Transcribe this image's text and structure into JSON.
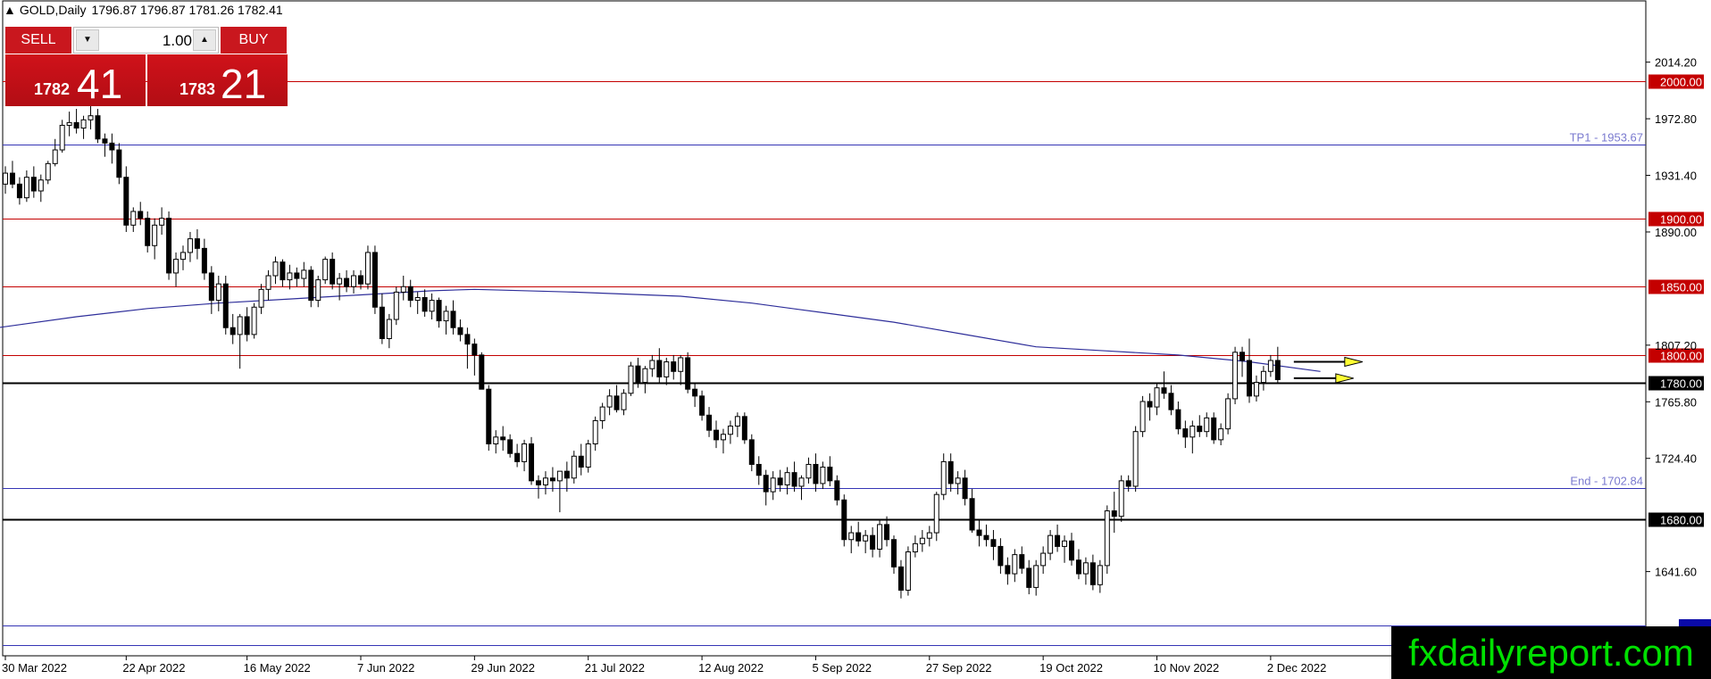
{
  "header": {
    "symbol": "GOLD,Daily",
    "ohlc": "1796.87 1796.87 1781.26 1782.41"
  },
  "trade_panel": {
    "sell_label": "SELL",
    "buy_label": "BUY",
    "lot": "1.00",
    "sell_price_small": "1782",
    "sell_price_big": "41",
    "buy_price_small": "1783",
    "buy_price_big": "21"
  },
  "brand": "fxdailyreport.com",
  "chart_data": {
    "type": "candlestick",
    "symbol": "GOLD",
    "timeframe": "Daily",
    "y_range": [
      1580,
      2059
    ],
    "y_ticks": [
      "2014.20",
      "1972.80",
      "1931.40",
      "1890.00",
      "1807.20",
      "1765.80",
      "1724.40",
      "1641.60"
    ],
    "x_ticks": [
      {
        "label": "30 Mar 2022",
        "index": 0
      },
      {
        "label": "22 Apr 2022",
        "index": 17
      },
      {
        "label": "16 May 2022",
        "index": 34
      },
      {
        "label": "7 Jun 2022",
        "index": 50
      },
      {
        "label": "29 Jun 2022",
        "index": 66
      },
      {
        "label": "21 Jul 2022",
        "index": 82
      },
      {
        "label": "12 Aug 2022",
        "index": 98
      },
      {
        "label": "5 Sep 2022",
        "index": 114
      },
      {
        "label": "27 Sep 2022",
        "index": 130
      },
      {
        "label": "19 Oct 2022",
        "index": 146
      },
      {
        "label": "10 Nov 2022",
        "index": 162
      },
      {
        "label": "2 Dec 2022",
        "index": 178
      }
    ],
    "bars_total": 186,
    "levels": [
      {
        "price": 2000.0,
        "label": "2000.00",
        "style": "red"
      },
      {
        "price": 1953.67,
        "label": "TP1 - 1953.67",
        "style": "blue-text"
      },
      {
        "price": 1900.0,
        "label": "1900.00",
        "style": "red"
      },
      {
        "price": 1850.0,
        "label": "1850.00",
        "style": "red"
      },
      {
        "price": 1800.0,
        "label": "1800.00",
        "style": "red"
      },
      {
        "price": 1780.0,
        "label": "1780.00",
        "style": "black"
      },
      {
        "price": 1702.84,
        "label": "End - 1702.84",
        "style": "blue-text"
      },
      {
        "price": 1680.0,
        "label": "1680.00",
        "style": "black"
      },
      {
        "price": 1602.0,
        "label": "",
        "style": "blue"
      },
      {
        "price": 1588.0,
        "label": "",
        "style": "blue"
      }
    ],
    "moving_average": {
      "color": "#2e2e9a",
      "points": [
        [
          -1,
          1820
        ],
        [
          10,
          1828
        ],
        [
          20,
          1834
        ],
        [
          30,
          1838
        ],
        [
          40,
          1841
        ],
        [
          50,
          1844
        ],
        [
          60,
          1847
        ],
        [
          66,
          1848
        ],
        [
          80,
          1846
        ],
        [
          95,
          1843
        ],
        [
          105,
          1838
        ],
        [
          115,
          1831
        ],
        [
          125,
          1824
        ],
        [
          135,
          1815
        ],
        [
          145,
          1806
        ],
        [
          155,
          1803
        ],
        [
          165,
          1800
        ],
        [
          175,
          1795
        ],
        [
          185,
          1788
        ]
      ]
    },
    "candles": [
      [
        1925,
        1938,
        1918,
        1933
      ],
      [
        1933,
        1942,
        1922,
        1925
      ],
      [
        1925,
        1930,
        1910,
        1915
      ],
      [
        1915,
        1935,
        1912,
        1930
      ],
      [
        1930,
        1938,
        1915,
        1920
      ],
      [
        1920,
        1932,
        1912,
        1928
      ],
      [
        1928,
        1942,
        1925,
        1940
      ],
      [
        1940,
        1958,
        1938,
        1950
      ],
      [
        1950,
        1972,
        1948,
        1968
      ],
      [
        1968,
        1978,
        1960,
        1970
      ],
      [
        1970,
        1980,
        1962,
        1966
      ],
      [
        1966,
        1975,
        1958,
        1972
      ],
      [
        1972,
        1990,
        1965,
        1975
      ],
      [
        1975,
        1980,
        1955,
        1958
      ],
      [
        1958,
        1962,
        1945,
        1955
      ],
      [
        1955,
        1962,
        1940,
        1950
      ],
      [
        1950,
        1955,
        1925,
        1930
      ],
      [
        1930,
        1938,
        1890,
        1895
      ],
      [
        1895,
        1908,
        1890,
        1905
      ],
      [
        1905,
        1912,
        1895,
        1900
      ],
      [
        1900,
        1905,
        1875,
        1880
      ],
      [
        1880,
        1900,
        1870,
        1895
      ],
      [
        1895,
        1908,
        1888,
        1900
      ],
      [
        1900,
        1905,
        1855,
        1860
      ],
      [
        1860,
        1875,
        1850,
        1870
      ],
      [
        1870,
        1880,
        1862,
        1875
      ],
      [
        1875,
        1890,
        1868,
        1885
      ],
      [
        1885,
        1892,
        1870,
        1878
      ],
      [
        1878,
        1885,
        1855,
        1860
      ],
      [
        1860,
        1865,
        1830,
        1840
      ],
      [
        1840,
        1858,
        1832,
        1852
      ],
      [
        1852,
        1858,
        1815,
        1820
      ],
      [
        1820,
        1830,
        1808,
        1815
      ],
      [
        1815,
        1830,
        1790,
        1828
      ],
      [
        1828,
        1835,
        1810,
        1815
      ],
      [
        1815,
        1838,
        1812,
        1835
      ],
      [
        1835,
        1852,
        1830,
        1848
      ],
      [
        1848,
        1862,
        1840,
        1858
      ],
      [
        1858,
        1872,
        1852,
        1868
      ],
      [
        1868,
        1870,
        1850,
        1855
      ],
      [
        1855,
        1866,
        1848,
        1860
      ],
      [
        1860,
        1864,
        1850,
        1856
      ],
      [
        1856,
        1868,
        1850,
        1862
      ],
      [
        1862,
        1865,
        1835,
        1840
      ],
      [
        1840,
        1858,
        1835,
        1855
      ],
      [
        1855,
        1872,
        1852,
        1870
      ],
      [
        1870,
        1875,
        1848,
        1852
      ],
      [
        1852,
        1860,
        1840,
        1856
      ],
      [
        1856,
        1862,
        1846,
        1850
      ],
      [
        1850,
        1862,
        1845,
        1858
      ],
      [
        1858,
        1862,
        1848,
        1852
      ],
      [
        1852,
        1880,
        1848,
        1875
      ],
      [
        1875,
        1880,
        1830,
        1835
      ],
      [
        1835,
        1845,
        1808,
        1812
      ],
      [
        1812,
        1830,
        1805,
        1826
      ],
      [
        1826,
        1850,
        1822,
        1846
      ],
      [
        1846,
        1858,
        1840,
        1850
      ],
      [
        1850,
        1855,
        1835,
        1840
      ],
      [
        1840,
        1846,
        1830,
        1842
      ],
      [
        1842,
        1848,
        1828,
        1832
      ],
      [
        1832,
        1845,
        1826,
        1840
      ],
      [
        1840,
        1842,
        1820,
        1825
      ],
      [
        1825,
        1836,
        1815,
        1832
      ],
      [
        1832,
        1840,
        1815,
        1820
      ],
      [
        1820,
        1826,
        1810,
        1815
      ],
      [
        1815,
        1820,
        1790,
        1808
      ],
      [
        1808,
        1812,
        1785,
        1800
      ],
      [
        1800,
        1802,
        1775,
        1775
      ],
      [
        1775,
        1778,
        1730,
        1735
      ],
      [
        1735,
        1745,
        1728,
        1740
      ],
      [
        1740,
        1748,
        1730,
        1738
      ],
      [
        1738,
        1742,
        1725,
        1728
      ],
      [
        1728,
        1735,
        1718,
        1722
      ],
      [
        1722,
        1738,
        1715,
        1735
      ],
      [
        1735,
        1740,
        1705,
        1708
      ],
      [
        1708,
        1712,
        1695,
        1705
      ],
      [
        1705,
        1715,
        1698,
        1710
      ],
      [
        1710,
        1718,
        1700,
        1708
      ],
      [
        1708,
        1712,
        1685,
        1715
      ],
      [
        1715,
        1722,
        1700,
        1710
      ],
      [
        1710,
        1730,
        1706,
        1726
      ],
      [
        1726,
        1735,
        1712,
        1718
      ],
      [
        1718,
        1738,
        1714,
        1735
      ],
      [
        1735,
        1755,
        1730,
        1752
      ],
      [
        1752,
        1765,
        1746,
        1762
      ],
      [
        1762,
        1775,
        1756,
        1770
      ],
      [
        1770,
        1778,
        1758,
        1760
      ],
      [
        1760,
        1775,
        1756,
        1772
      ],
      [
        1772,
        1795,
        1770,
        1792
      ],
      [
        1792,
        1798,
        1776,
        1780
      ],
      [
        1780,
        1792,
        1772,
        1790
      ],
      [
        1790,
        1800,
        1784,
        1796
      ],
      [
        1796,
        1805,
        1780,
        1784
      ],
      [
        1784,
        1798,
        1778,
        1795
      ],
      [
        1795,
        1800,
        1782,
        1788
      ],
      [
        1788,
        1800,
        1778,
        1798
      ],
      [
        1798,
        1802,
        1772,
        1775
      ],
      [
        1775,
        1780,
        1762,
        1770
      ],
      [
        1770,
        1774,
        1752,
        1756
      ],
      [
        1756,
        1762,
        1740,
        1745
      ],
      [
        1745,
        1752,
        1732,
        1738
      ],
      [
        1738,
        1746,
        1728,
        1742
      ],
      [
        1742,
        1752,
        1735,
        1748
      ],
      [
        1748,
        1758,
        1740,
        1755
      ],
      [
        1755,
        1758,
        1735,
        1738
      ],
      [
        1738,
        1742,
        1715,
        1720
      ],
      [
        1720,
        1726,
        1705,
        1712
      ],
      [
        1712,
        1716,
        1690,
        1700
      ],
      [
        1700,
        1715,
        1694,
        1710
      ],
      [
        1710,
        1716,
        1700,
        1705
      ],
      [
        1705,
        1718,
        1698,
        1714
      ],
      [
        1714,
        1722,
        1700,
        1704
      ],
      [
        1704,
        1712,
        1694,
        1710
      ],
      [
        1710,
        1725,
        1706,
        1720
      ],
      [
        1720,
        1728,
        1700,
        1706
      ],
      [
        1706,
        1722,
        1702,
        1718
      ],
      [
        1718,
        1726,
        1704,
        1708
      ],
      [
        1708,
        1712,
        1690,
        1694
      ],
      [
        1694,
        1698,
        1660,
        1665
      ],
      [
        1665,
        1675,
        1655,
        1670
      ],
      [
        1670,
        1678,
        1660,
        1664
      ],
      [
        1664,
        1672,
        1655,
        1668
      ],
      [
        1668,
        1674,
        1652,
        1658
      ],
      [
        1658,
        1680,
        1652,
        1676
      ],
      [
        1676,
        1682,
        1660,
        1665
      ],
      [
        1665,
        1668,
        1640,
        1645
      ],
      [
        1645,
        1650,
        1622,
        1628
      ],
      [
        1628,
        1660,
        1624,
        1656
      ],
      [
        1656,
        1668,
        1652,
        1662
      ],
      [
        1662,
        1672,
        1656,
        1666
      ],
      [
        1666,
        1675,
        1660,
        1670
      ],
      [
        1670,
        1700,
        1664,
        1698
      ],
      [
        1698,
        1728,
        1694,
        1722
      ],
      [
        1722,
        1728,
        1700,
        1706
      ],
      [
        1706,
        1715,
        1698,
        1710
      ],
      [
        1710,
        1716,
        1690,
        1695
      ],
      [
        1695,
        1702,
        1670,
        1672
      ],
      [
        1672,
        1680,
        1660,
        1668
      ],
      [
        1668,
        1676,
        1660,
        1665
      ],
      [
        1665,
        1672,
        1650,
        1660
      ],
      [
        1660,
        1666,
        1640,
        1646
      ],
      [
        1646,
        1652,
        1632,
        1640
      ],
      [
        1640,
        1658,
        1634,
        1654
      ],
      [
        1654,
        1660,
        1640,
        1644
      ],
      [
        1644,
        1650,
        1625,
        1630
      ],
      [
        1630,
        1650,
        1624,
        1646
      ],
      [
        1646,
        1660,
        1640,
        1655
      ],
      [
        1655,
        1672,
        1650,
        1668
      ],
      [
        1668,
        1676,
        1656,
        1660
      ],
      [
        1660,
        1668,
        1648,
        1664
      ],
      [
        1664,
        1670,
        1646,
        1650
      ],
      [
        1650,
        1658,
        1636,
        1640
      ],
      [
        1640,
        1652,
        1632,
        1648
      ],
      [
        1648,
        1654,
        1628,
        1632
      ],
      [
        1632,
        1650,
        1626,
        1646
      ],
      [
        1646,
        1690,
        1640,
        1686
      ],
      [
        1686,
        1700,
        1670,
        1682
      ],
      [
        1682,
        1712,
        1678,
        1708
      ],
      [
        1708,
        1712,
        1700,
        1704
      ],
      [
        1704,
        1748,
        1700,
        1744
      ],
      [
        1744,
        1770,
        1740,
        1766
      ],
      [
        1766,
        1772,
        1752,
        1762
      ],
      [
        1762,
        1780,
        1756,
        1776
      ],
      [
        1776,
        1788,
        1768,
        1772
      ],
      [
        1772,
        1778,
        1756,
        1760
      ],
      [
        1760,
        1766,
        1742,
        1746
      ],
      [
        1746,
        1752,
        1732,
        1740
      ],
      [
        1740,
        1752,
        1728,
        1748
      ],
      [
        1748,
        1756,
        1740,
        1744
      ],
      [
        1744,
        1758,
        1740,
        1754
      ],
      [
        1754,
        1758,
        1735,
        1738
      ],
      [
        1738,
        1750,
        1734,
        1746
      ],
      [
        1746,
        1772,
        1742,
        1768
      ],
      [
        1768,
        1806,
        1764,
        1802
      ],
      [
        1802,
        1806,
        1784,
        1796
      ],
      [
        1796,
        1812,
        1765,
        1770
      ],
      [
        1770,
        1785,
        1766,
        1780
      ],
      [
        1780,
        1792,
        1774,
        1788
      ],
      [
        1788,
        1800,
        1784,
        1796
      ],
      [
        1796,
        1806,
        1780,
        1782
      ]
    ]
  }
}
